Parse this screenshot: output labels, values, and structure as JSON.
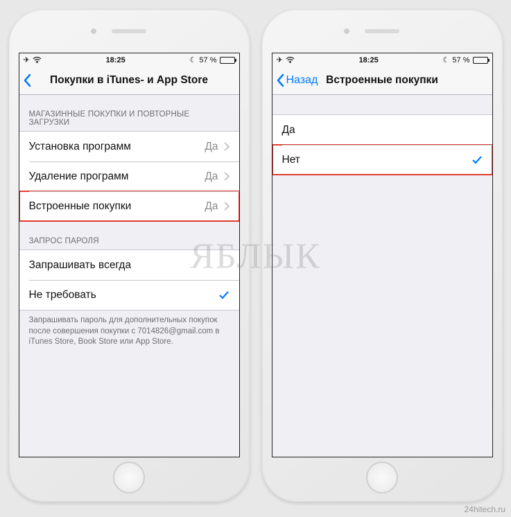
{
  "status": {
    "time": "18:25",
    "battery_pct": "57 %",
    "battery_fill": 57
  },
  "left": {
    "nav_title": "Покупки в iTunes- и App Store",
    "section1_header": "МАГАЗИННЫЕ ПОКУПКИ И ПОВТОРНЫЕ ЗАГРУЗКИ",
    "rows1": [
      {
        "label": "Установка программ",
        "value": "Да"
      },
      {
        "label": "Удаление программ",
        "value": "Да"
      },
      {
        "label": "Встроенные покупки",
        "value": "Да"
      }
    ],
    "section2_header": "ЗАПРОС ПАРОЛЯ",
    "rows2": [
      {
        "label": "Запрашивать всегда"
      },
      {
        "label": "Не требовать"
      }
    ],
    "footer": "Запрашивать пароль для дополнительных покупок после совершения покупки с 7014826@gmail.com в iTunes Store, Book Store или App Store."
  },
  "right": {
    "back_label": "Назад",
    "nav_title": "Встроенные покупки",
    "options": [
      {
        "label": "Да"
      },
      {
        "label": "Нет"
      }
    ]
  },
  "watermark": "ЯБЛЫК",
  "credit": "24hitech.ru"
}
